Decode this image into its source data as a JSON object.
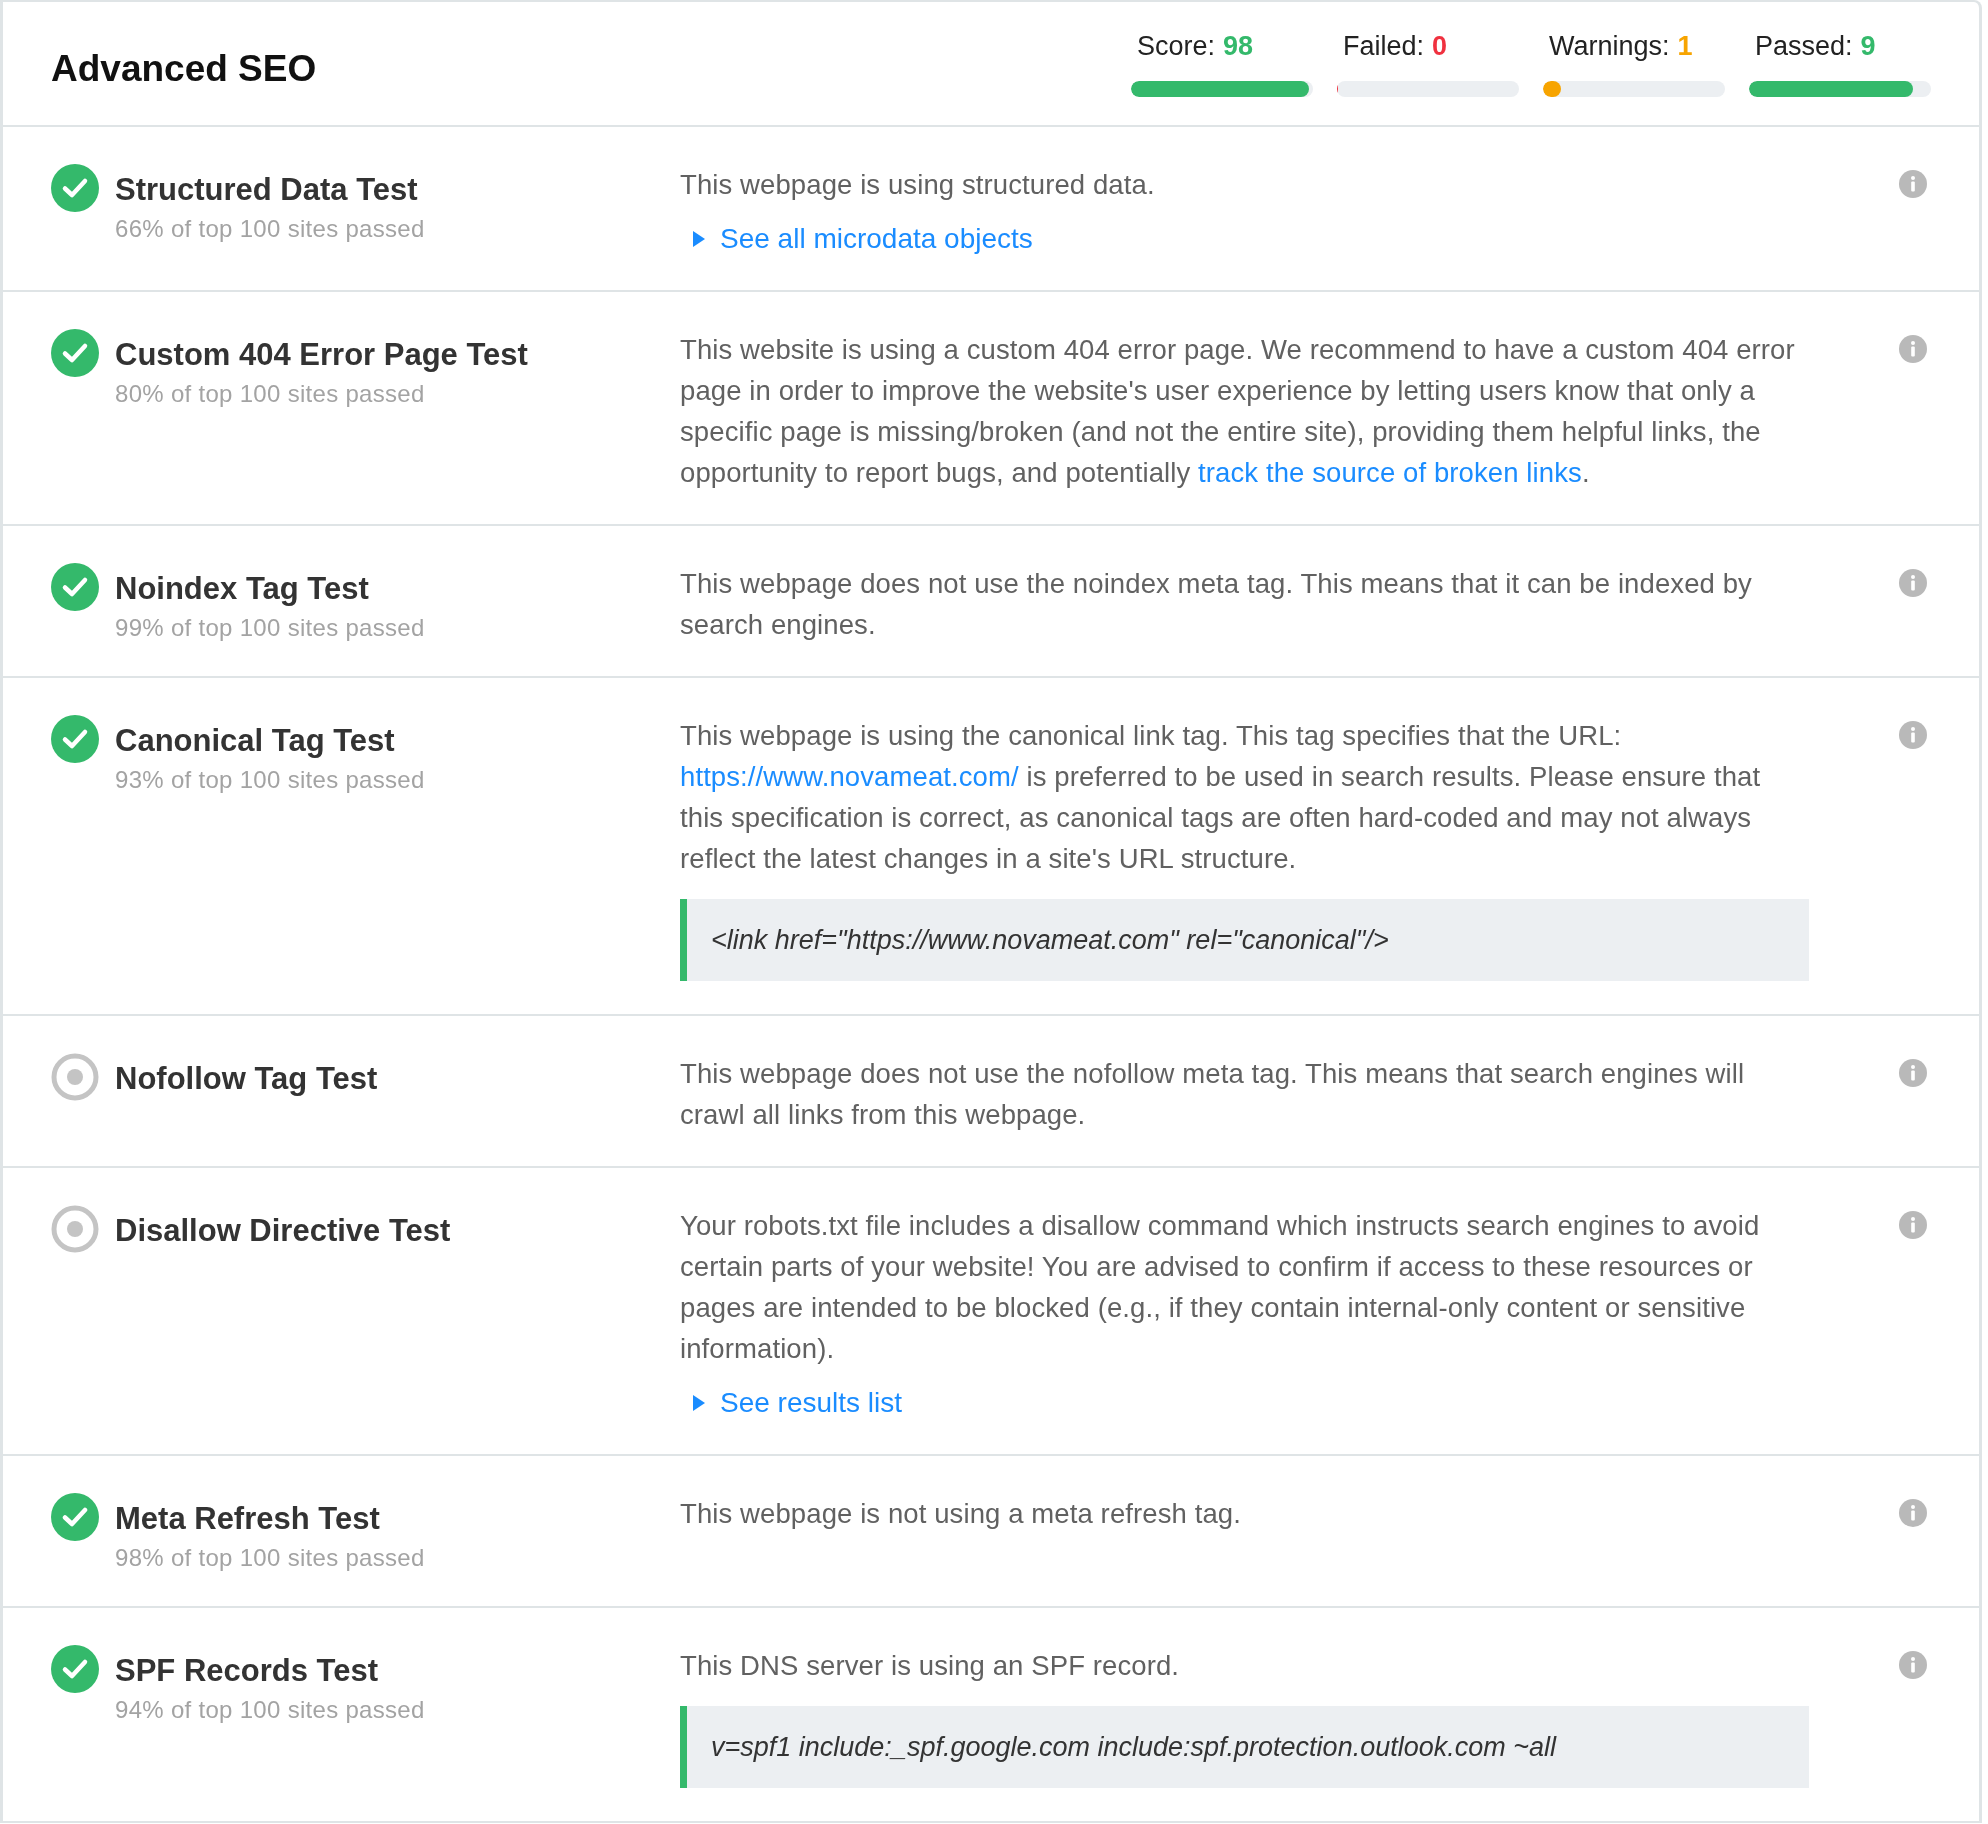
{
  "header": {
    "title": "Advanced SEO",
    "stats": [
      {
        "label": "Score:",
        "value": "98",
        "color": "#34b96b",
        "level": 0.98
      },
      {
        "label": "Failed:",
        "value": "0",
        "color": "#f0313f",
        "level": 0
      },
      {
        "label": "Warnings:",
        "value": "1",
        "color": "#f7a400",
        "level": 0.1
      },
      {
        "label": "Passed:",
        "value": "9",
        "color": "#34b96b",
        "level": 0.9
      }
    ]
  },
  "tests": [
    {
      "kind": "passed",
      "title": "Structured Data Test",
      "sub": "66% of top 100 sites passed",
      "description": [
        {
          "kind": "text",
          "text": "This webpage is using structured data."
        }
      ],
      "toggle": {
        "label": "See all microdata objects",
        "expanded": false
      }
    },
    {
      "kind": "passed",
      "title": "Custom 404 Error Page Test",
      "sub": "80% of top 100 sites passed",
      "description": [
        {
          "kind": "text",
          "text": "This website is using a custom 404 error page. We recommend to have a custom 404 error page in order to improve the website's user experience by letting users know that only a specific page is missing/broken (and not the entire site), providing them helpful links, the opportunity to report bugs, and potentially "
        },
        {
          "kind": "link",
          "text": "track the source of broken links"
        },
        {
          "kind": "text",
          "text": "."
        }
      ]
    },
    {
      "kind": "passed",
      "title": "Noindex Tag Test",
      "sub": "99% of top 100 sites passed",
      "description": [
        {
          "kind": "text",
          "text": "This webpage does not use the noindex meta tag. This means that it can be indexed by search engines."
        }
      ]
    },
    {
      "kind": "passed",
      "title": "Canonical Tag Test",
      "sub": "93% of top 100 sites passed",
      "description": [
        {
          "kind": "text",
          "text": "This webpage is using the canonical link tag. This tag specifies that the URL: "
        },
        {
          "kind": "link",
          "text": "https://www.novameat.com/"
        },
        {
          "kind": "text",
          "text": " is preferred to be used in search results. Please ensure that this specification is correct, as canonical tags are often hard-coded and may not always reflect the latest changes in a site's URL structure."
        }
      ],
      "code": "<link href=\"https://www.novameat.com\" rel=\"canonical\"/>"
    },
    {
      "kind": "info",
      "title": "Nofollow Tag Test",
      "description": [
        {
          "kind": "text",
          "text": "This webpage does not use the nofollow meta tag. This means that search engines will crawl all links from this webpage."
        }
      ]
    },
    {
      "kind": "info",
      "title": "Disallow Directive Test",
      "description": [
        {
          "kind": "text",
          "text": "Your robots.txt file includes a disallow command which instructs search engines to avoid certain parts of your website! You are advised to confirm if access to these resources or pages are intended to be blocked (e.g., if they contain internal-only content or sensitive information)."
        }
      ],
      "toggle": {
        "label": "See results list",
        "expanded": false
      }
    },
    {
      "kind": "passed",
      "title": "Meta Refresh Test",
      "sub": "98% of top 100 sites passed",
      "description": [
        {
          "kind": "text",
          "text": "This webpage is not using a meta refresh tag."
        }
      ]
    },
    {
      "kind": "passed",
      "title": "SPF Records Test",
      "sub": "94% of top 100 sites passed",
      "description": [
        {
          "kind": "text",
          "text": "This DNS server is using an SPF record."
        }
      ],
      "code": "v=spf1 include:_spf.google.com include:spf.protection.outlook.com ~all"
    }
  ]
}
